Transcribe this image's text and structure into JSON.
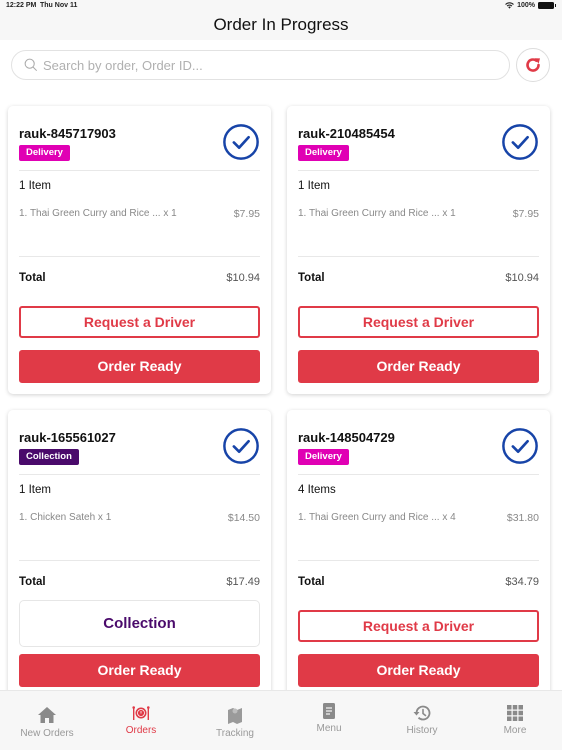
{
  "status_bar": {
    "time": "12:22 PM",
    "date": "Thu Nov 11",
    "battery": "100%"
  },
  "header": {
    "title": "Order In Progress"
  },
  "search": {
    "placeholder": "Search by order, Order ID...",
    "value": ""
  },
  "colors": {
    "accent": "#e03a47",
    "delivery": "#e000b4",
    "collection": "#4a0a6b",
    "check": "#1744a8"
  },
  "orders": [
    {
      "id": "rauk-845717903",
      "type": "Delivery",
      "item_count": "1 Item",
      "items": [
        {
          "line": "1. Thai Green Curry and Rice ... x 1",
          "price": "$7.95"
        }
      ],
      "total_label": "Total",
      "total": "$10.94",
      "primary_action": "Request a Driver",
      "secondary_action": "Order Ready"
    },
    {
      "id": "rauk-210485454",
      "type": "Delivery",
      "item_count": "1 Item",
      "items": [
        {
          "line": "1. Thai Green Curry and Rice ... x 1",
          "price": "$7.95"
        }
      ],
      "total_label": "Total",
      "total": "$10.94",
      "primary_action": "Request a Driver",
      "secondary_action": "Order Ready"
    },
    {
      "id": "rauk-165561027",
      "type": "Collection",
      "item_count": "1 Item",
      "items": [
        {
          "line": "1. Chicken Sateh x 1",
          "price": "$14.50"
        }
      ],
      "total_label": "Total",
      "total": "$17.49",
      "primary_action": "Collection",
      "secondary_action": "Order Ready"
    },
    {
      "id": "rauk-148504729",
      "type": "Delivery",
      "item_count": "4 Items",
      "items": [
        {
          "line": "1. Thai Green Curry and Rice ... x 4",
          "price": "$31.80"
        }
      ],
      "total_label": "Total",
      "total": "$34.79",
      "primary_action": "Request a Driver",
      "secondary_action": "Order Ready"
    }
  ],
  "tabbar": {
    "items": [
      {
        "label": "New Orders",
        "icon": "home-icon",
        "active": false
      },
      {
        "label": "Orders",
        "icon": "orders-icon",
        "active": true
      },
      {
        "label": "Tracking",
        "icon": "map-icon",
        "active": false
      },
      {
        "label": "Menu",
        "icon": "menu-document-icon",
        "active": false
      },
      {
        "label": "History",
        "icon": "history-icon",
        "active": false
      },
      {
        "label": "More",
        "icon": "grid-icon",
        "active": false
      }
    ]
  }
}
